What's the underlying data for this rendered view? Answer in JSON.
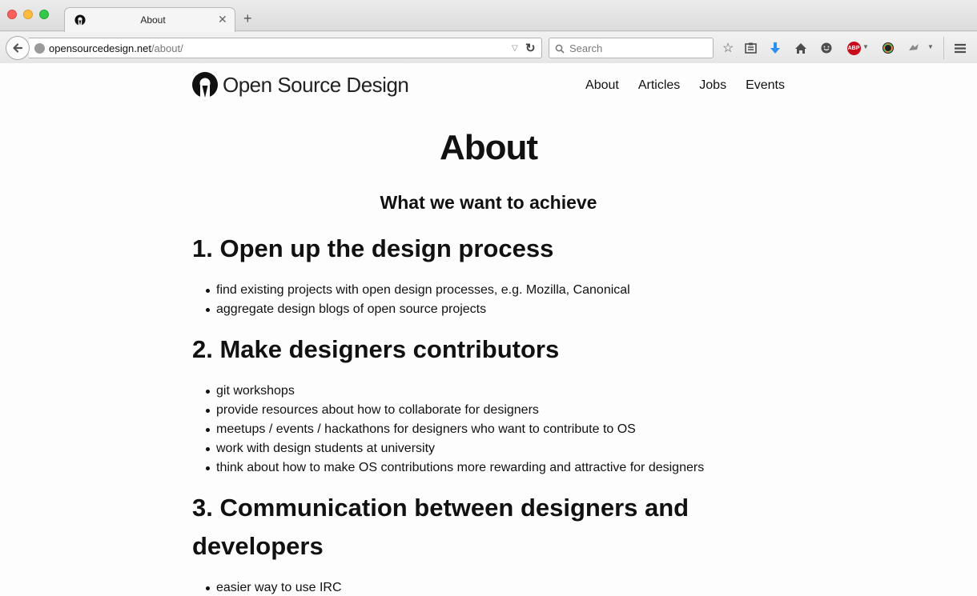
{
  "browser": {
    "tab_title": "About",
    "url_host": "opensourcedesign.net",
    "url_path": "/about/",
    "search_placeholder": "Search",
    "abp_label": "ABP"
  },
  "site": {
    "logo_text": "Open Source Design",
    "nav": [
      "About",
      "Articles",
      "Jobs",
      "Events"
    ]
  },
  "content": {
    "title": "About",
    "subtitle": "What we want to achieve",
    "sections": [
      {
        "heading": "1. Open up the design process",
        "items": [
          "find existing projects with open design processes, e.g. Mozilla, Canonical",
          "aggregate design blogs of open source projects"
        ]
      },
      {
        "heading": "2. Make designers contributors",
        "items": [
          "git workshops",
          "provide resources about how to collaborate for designers",
          "meetups / events / hackathons for designers who want to contribute to OS",
          "work with design students at university",
          "think about how to make OS contributions more rewarding and attractive for designers"
        ]
      },
      {
        "heading_line1": "3. Communication between designers and",
        "heading_line2": "developers",
        "items": [
          "easier way to use IRC"
        ]
      }
    ]
  },
  "colors": {
    "traffic_red": "#fc605c",
    "traffic_yellow": "#fdbc40",
    "traffic_green": "#34c84a",
    "download_arrow": "#2e8ff0",
    "abp_red": "#c70d1b"
  }
}
